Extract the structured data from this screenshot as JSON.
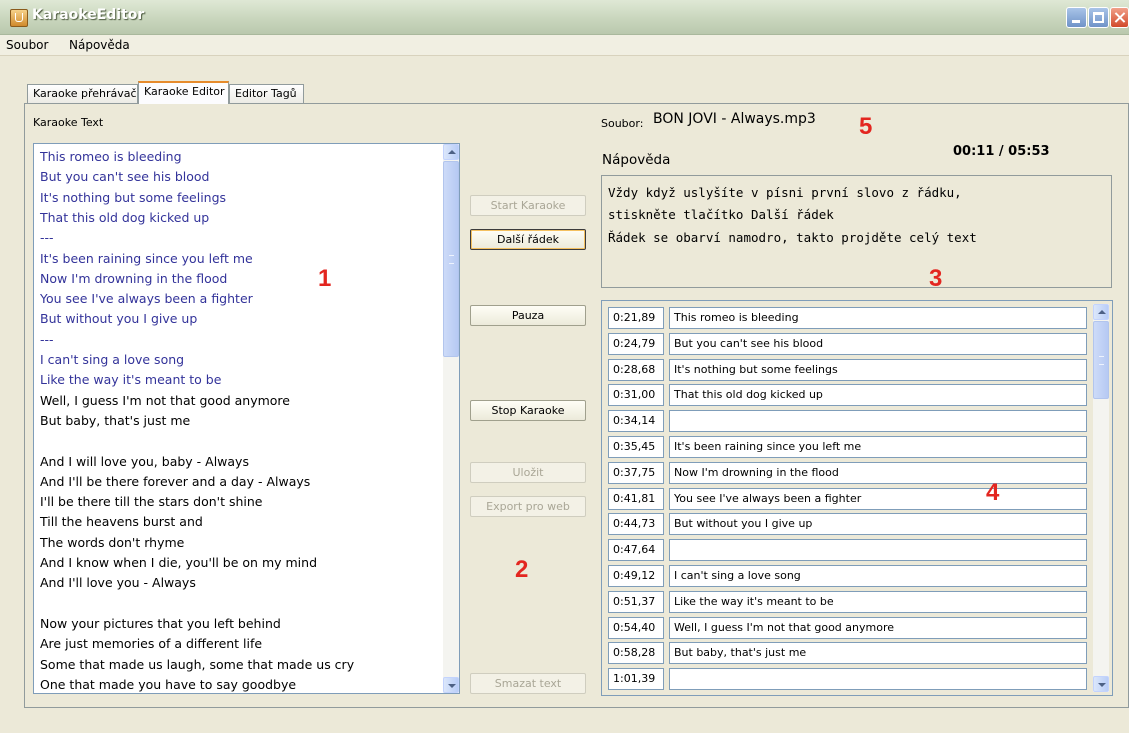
{
  "window": {
    "title": "KaraokeEditor"
  },
  "menu": {
    "items": [
      "Soubor",
      "Nápověda"
    ]
  },
  "tabs": [
    {
      "label": "Karaoke přehrávač",
      "active": false
    },
    {
      "label": "Karaoke Editor",
      "active": true
    },
    {
      "label": "Editor Tagů",
      "active": false
    }
  ],
  "editor": {
    "text_label": "Karaoke Text",
    "lyrics": [
      {
        "text": "This romeo is bleeding",
        "sung": true
      },
      {
        "text": "But you can't see his blood",
        "sung": true
      },
      {
        "text": "It's nothing but some feelings",
        "sung": true
      },
      {
        "text": "That this old dog kicked up",
        "sung": true
      },
      {
        "text": " ---",
        "sung": true
      },
      {
        "text": "It's been raining since you left me",
        "sung": true
      },
      {
        "text": "Now I'm drowning in the flood",
        "sung": true
      },
      {
        "text": "You see I've always been a fighter",
        "sung": true
      },
      {
        "text": "But without you I give up",
        "sung": true
      },
      {
        "text": " ---",
        "sung": true
      },
      {
        "text": "I can't sing a love song",
        "sung": true
      },
      {
        "text": "Like the way it's meant to be",
        "sung": true
      },
      {
        "text": "Well, I guess I'm not that good anymore",
        "sung": false
      },
      {
        "text": "But baby, that's just me",
        "sung": false
      },
      {
        "text": "",
        "sung": false
      },
      {
        "text": "And I will love you, baby - Always",
        "sung": false
      },
      {
        "text": "And I'll be there forever and a day - Always",
        "sung": false
      },
      {
        "text": "I'll be there till the stars don't shine",
        "sung": false
      },
      {
        "text": "Till the heavens burst and",
        "sung": false
      },
      {
        "text": "The words don't rhyme",
        "sung": false
      },
      {
        "text": "And I know when I die, you'll be on my mind",
        "sung": false
      },
      {
        "text": "And I'll love you - Always",
        "sung": false
      },
      {
        "text": "",
        "sung": false
      },
      {
        "text": "Now your pictures that you left behind",
        "sung": false
      },
      {
        "text": "Are just memories of a different life",
        "sung": false
      },
      {
        "text": "Some that made us laugh, some that made us cry",
        "sung": false
      },
      {
        "text": "One that made you have to say goodbye",
        "sung": false
      }
    ],
    "buttons": {
      "start": "Start Karaoke",
      "next_line": "Další řádek",
      "pause": "Pauza",
      "stop": "Stop Karaoke",
      "save": "Uložit",
      "export": "Export pro web",
      "clear": "Smazat text"
    },
    "file_label": "Soubor:",
    "file_name": "BON JOVI - Always.mp3",
    "time": "00:11 / 05:53",
    "help_label": "Nápověda",
    "help_lines": [
      "Vždy když uslyšíte v písni první slovo z řádku,",
      "stiskněte tlačítko Další řádek",
      "Řádek se obarví namodro, takto projděte celý text"
    ],
    "tags": [
      {
        "time": "0:21,89",
        "text": "This romeo is bleeding"
      },
      {
        "time": "0:24,79",
        "text": "But you can't see his blood"
      },
      {
        "time": "0:28,68",
        "text": "It's nothing but some feelings"
      },
      {
        "time": "0:31,00",
        "text": "That this old dog kicked up"
      },
      {
        "time": "0:34,14",
        "text": ""
      },
      {
        "time": "0:35,45",
        "text": "It's been raining since you left me"
      },
      {
        "time": "0:37,75",
        "text": "Now I'm drowning in the flood"
      },
      {
        "time": "0:41,81",
        "text": "You see I've always been a fighter"
      },
      {
        "time": "0:44,73",
        "text": "But without you I give up"
      },
      {
        "time": "0:47,64",
        "text": ""
      },
      {
        "time": "0:49,12",
        "text": "I can't sing a love song"
      },
      {
        "time": "0:51,37",
        "text": "Like the way it's meant to be"
      },
      {
        "time": "0:54,40",
        "text": "Well, I guess I'm not that good anymore"
      },
      {
        "time": "0:58,28",
        "text": "But baby, that's just me"
      },
      {
        "time": "1:01,39",
        "text": ""
      }
    ]
  },
  "annotations": [
    "1",
    "2",
    "3",
    "4",
    "5"
  ],
  "colors": {
    "sung_text": "#33339a",
    "annotation": "#e32620",
    "tab_accent": "#e68b2c"
  }
}
